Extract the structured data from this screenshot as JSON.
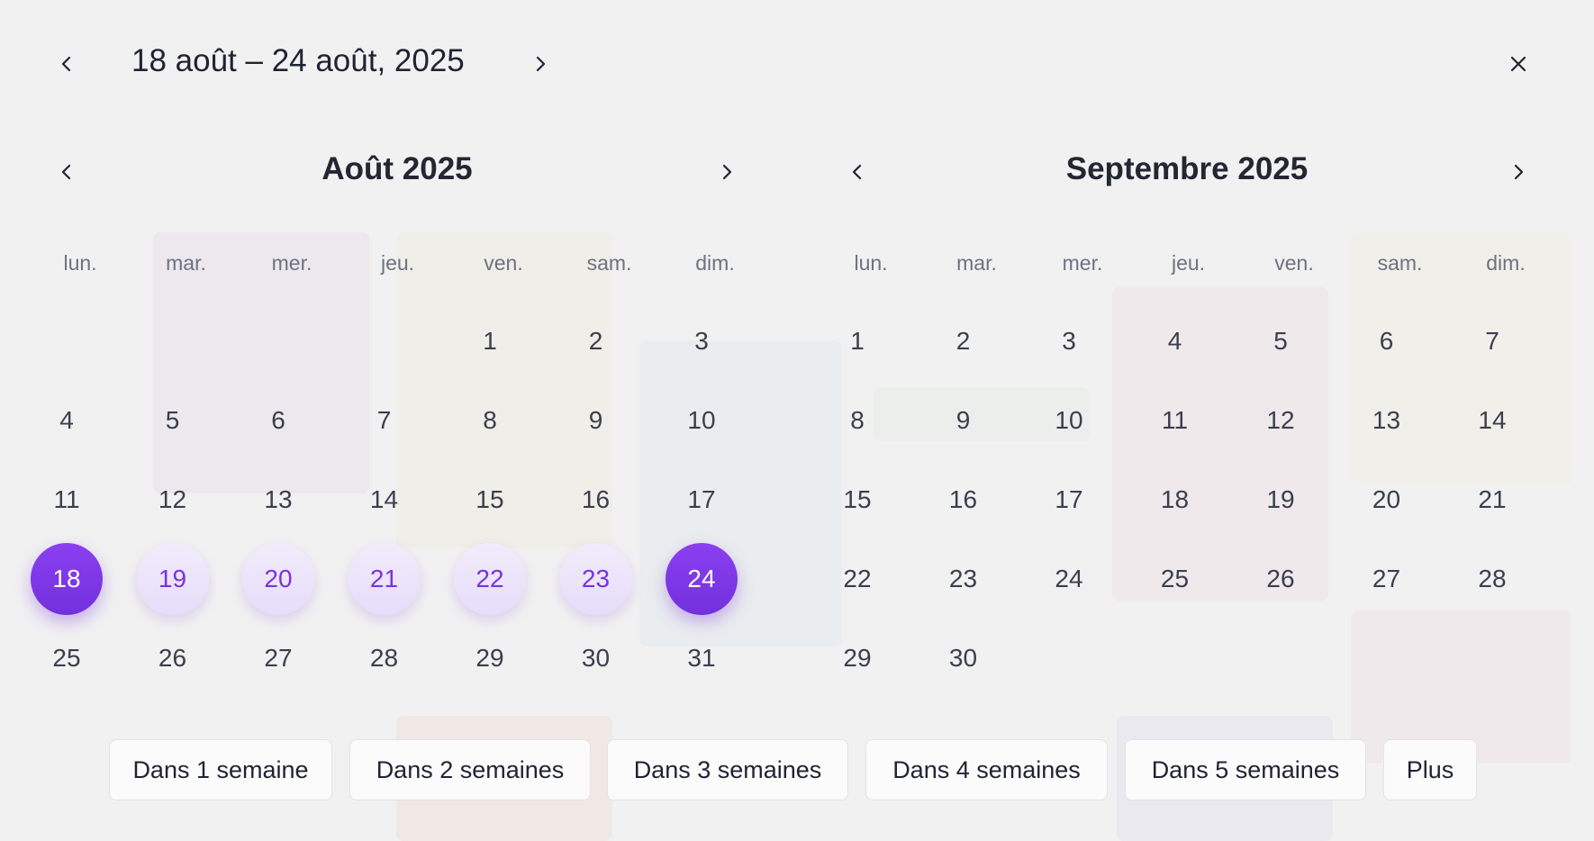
{
  "header": {
    "range_title": "18 août – 24 août, 2025"
  },
  "icons": {
    "prev": "chevron-left-icon",
    "next": "chevron-right-icon",
    "close": "close-icon"
  },
  "weekdays": [
    "lun.",
    "mar.",
    "mer.",
    "jeu.",
    "ven.",
    "sam.",
    "dim."
  ],
  "months": [
    {
      "title": "Août 2025",
      "weeks": [
        [
          "",
          "",
          "",
          "",
          "1",
          "2",
          "3"
        ],
        [
          "4",
          "5",
          "6",
          "7",
          "8",
          "9",
          "10"
        ],
        [
          "11",
          "12",
          "13",
          "14",
          "15",
          "16",
          "17"
        ],
        [
          "18",
          "19",
          "20",
          "21",
          "22",
          "23",
          "24"
        ],
        [
          "25",
          "26",
          "27",
          "28",
          "29",
          "30",
          "31"
        ]
      ],
      "range_start": "18",
      "range_end": "24"
    },
    {
      "title": "Septembre 2025",
      "weeks": [
        [
          "1",
          "2",
          "3",
          "4",
          "5",
          "6",
          "7"
        ],
        [
          "8",
          "9",
          "10",
          "11",
          "12",
          "13",
          "14"
        ],
        [
          "15",
          "16",
          "17",
          "18",
          "19",
          "20",
          "21"
        ],
        [
          "22",
          "23",
          "24",
          "25",
          "26",
          "27",
          "28"
        ],
        [
          "29",
          "30",
          "",
          "",
          "",
          "",
          ""
        ]
      ],
      "range_start": "",
      "range_end": ""
    }
  ],
  "quick_options": [
    "Dans 1 semaine",
    "Dans 2 semaines",
    "Dans 3 semaines",
    "Dans 4 semaines",
    "Dans 5 semaines",
    "Plus"
  ],
  "colors": {
    "accent": "#7a32e0",
    "range_fill": "#e9e1fb",
    "background": "#f1f1f2"
  }
}
